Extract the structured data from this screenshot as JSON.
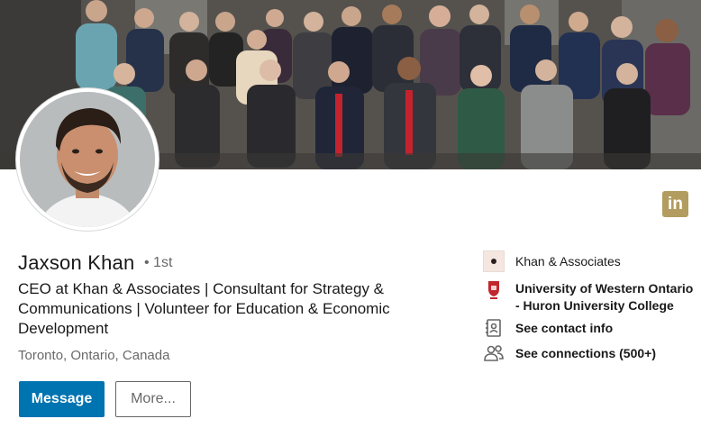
{
  "banner": {
    "alt": "group-photo"
  },
  "profile": {
    "name": "Jaxson Khan",
    "degree": "• 1st",
    "headline": "CEO at Khan & Associates | Consultant for Strategy & Communications | Volunteer for Education & Economic Development",
    "location": "Toronto, Ontario, Canada"
  },
  "badge": {
    "text": "in"
  },
  "actions": {
    "message_label": "Message",
    "more_label": "More..."
  },
  "sidebar": {
    "company": "Khan & Associates",
    "school": "University of Western Ontario - Huron University College",
    "contact": "See contact info",
    "connections": "See connections (500+)"
  },
  "colors": {
    "primary_button": "#0073b1",
    "linkedin_badge": "#b29c5f"
  }
}
